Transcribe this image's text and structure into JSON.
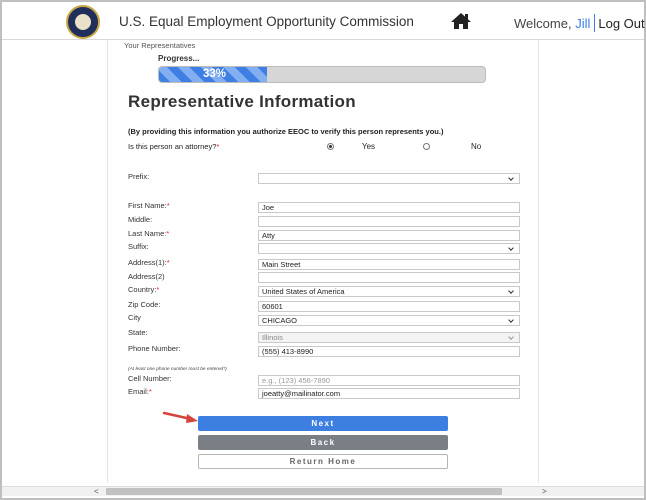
{
  "header": {
    "agency_name": "U.S. Equal Employment Opportunity Commission",
    "welcome_text": "Welcome,",
    "user_name": "Jill",
    "logout_label": "Log Out"
  },
  "breadcrumb": "Your Representatives",
  "progress": {
    "label": "Progress...",
    "percent_text": "33%",
    "value": 0.33
  },
  "page_title": "Representative Information",
  "notice": "(By providing this information you authorize EEOC to verify this person represents you.)",
  "attorney_question": {
    "label": "Is this person an attorney?",
    "required_mark": "*",
    "options": [
      "Yes",
      "No"
    ],
    "selected": "Yes"
  },
  "form": {
    "prefix": {
      "label": "Prefix:",
      "value": ""
    },
    "first_name": {
      "label": "First Name:",
      "required_mark": "*",
      "value": "Joe"
    },
    "middle": {
      "label": "Middle:",
      "value": ""
    },
    "last_name": {
      "label": "Last Name:",
      "required_mark": "*",
      "value": "Atty"
    },
    "suffix": {
      "label": "Suffix:",
      "value": ""
    },
    "address1": {
      "label": "Address(1):",
      "required_mark": "*",
      "value": "Main Street"
    },
    "address2": {
      "label": "Address(2)",
      "value": ""
    },
    "country": {
      "label": "Country:",
      "required_mark": "*",
      "value": "United States of America"
    },
    "zip": {
      "label": "Zip Code:",
      "value": "60601"
    },
    "city": {
      "label": "City",
      "value": "CHICAGO"
    },
    "state": {
      "label": "State:",
      "value": "Illinois"
    },
    "phone": {
      "label": "Phone Number:",
      "value": "(555) 413-8990",
      "hint": "(At least one phone number must be entered*)"
    },
    "cell": {
      "label": "Cell Number:",
      "placeholder": "e.g., (123) 456-7890"
    },
    "email": {
      "label": "Email:",
      "required_mark": "*",
      "value": "joeatty@mailinator.com"
    }
  },
  "buttons": {
    "next": "Next",
    "back": "Back",
    "return_home": "Return Home"
  },
  "scrollbar": {
    "left_arrow": "<",
    "right_arrow": ">"
  },
  "colors": {
    "accent": "#3d7fe0",
    "required": "#e0202c",
    "back_button": "#7a7f86",
    "arrow": "#d8433b"
  },
  "icons": {
    "home": "home-icon",
    "seal": "eeoc-seal-logo",
    "annotation": "red-arrow-annotation"
  }
}
